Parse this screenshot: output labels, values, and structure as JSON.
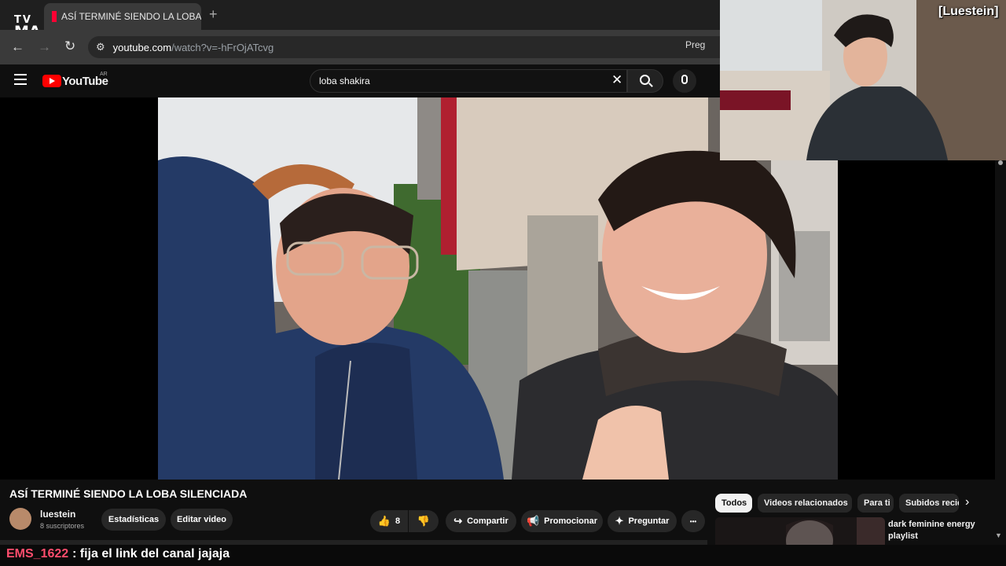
{
  "browser": {
    "tab_title": "ASÍ TERMINÉ SIENDO LA LOBA",
    "tab_close": "✕",
    "new_tab": "+",
    "url_domain": "youtube.com",
    "url_path": "/watch?v=-hFrOjATcvg",
    "back": "←",
    "forward": "→",
    "reload": "↻",
    "right_button": "Preg"
  },
  "overlay_logo": {
    "line1": "TV",
    "line2": "MA"
  },
  "youtube": {
    "wordmark": "YouTube",
    "country": "AR",
    "search_value": "loba shakira",
    "clear": "✕"
  },
  "webcam": {
    "name": "[Luestein]"
  },
  "video": {
    "title": "ASÍ TERMINÉ SIENDO LA LOBA SILENCIADA",
    "channel": "luestein",
    "subscribers": "8 suscriptores",
    "buttons": {
      "stats": "Estadísticas",
      "edit": "Editar video",
      "likes": "8",
      "share": "Compartir",
      "promote": "Promocionar",
      "ask": "Preguntar",
      "more": "•••"
    }
  },
  "chips": [
    "Todos",
    "Videos relacionados",
    "Para ti",
    "Subidos recie"
  ],
  "recommendation": {
    "title": "dark feminine energy playlist"
  },
  "chat": {
    "user": "EMS_1622",
    "message": ": fija el link del canal jajaja"
  },
  "colors": {
    "youtube_red": "#ff0000",
    "chat_user": "#ff4d6d",
    "background": "#0f0f0f"
  }
}
